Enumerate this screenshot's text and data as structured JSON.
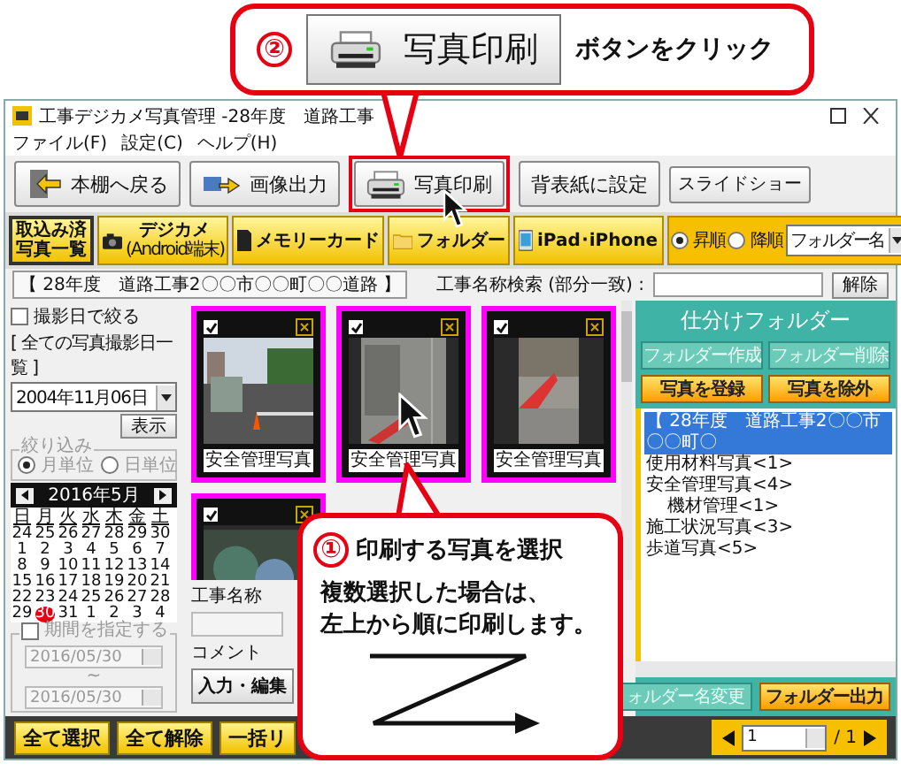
{
  "window": {
    "title": "工事デジカメ写真管理 -28年度　道路工事"
  },
  "menu": [
    "ファイル(F)",
    "設定(C)",
    "ヘルプ(H)"
  ],
  "toolbar": [
    {
      "label": "本棚へ戻る",
      "kind": "back",
      "highlighted": false
    },
    {
      "label": "画像出力",
      "kind": "export",
      "highlighted": false
    },
    {
      "label": "写真印刷",
      "kind": "print",
      "highlighted": true
    },
    {
      "label": "背表紙に設定",
      "kind": "plain",
      "highlighted": false
    },
    {
      "label": "スライドショー",
      "kind": "small",
      "highlighted": false
    }
  ],
  "sources": [
    {
      "lines": [
        "取込み済",
        "写真一覧"
      ],
      "kind": "list",
      "selected": true
    },
    {
      "lines": [
        "デジカメ",
        "(Android端末)"
      ],
      "kind": "camera",
      "selected": false
    },
    {
      "lines": [
        "メモリーカード"
      ],
      "kind": "card",
      "selected": false
    },
    {
      "lines": [
        "フォルダー"
      ],
      "kind": "folder",
      "selected": false
    },
    {
      "lines": [
        "iPad･iPhone"
      ],
      "kind": "tablet",
      "selected": false
    }
  ],
  "sort": {
    "options": [
      {
        "label": "昇順",
        "selected": true
      },
      {
        "label": "降順",
        "selected": false
      }
    ],
    "field": "フォルダー名"
  },
  "path": {
    "value": "【 28年度　道路工事2〇〇市〇〇町〇〇道路 】",
    "search_label": "工事名称検索 (部分一致) :",
    "clear": "解除"
  },
  "date_filter": {
    "label": "撮影日で絞る",
    "checked": false,
    "list_title": "[ 全ての写真撮影日一覧 ]",
    "date": "2004年11月06日",
    "show": "表示",
    "narrow_title": "絞り込み",
    "narrow": [
      {
        "label": "月単位",
        "selected": true
      },
      {
        "label": "日単位",
        "selected": false
      }
    ]
  },
  "calendar": {
    "month": "2016年5月",
    "weekdays": [
      "日",
      "月",
      "火",
      "水",
      "木",
      "金",
      "土"
    ],
    "weeks": [
      [
        {
          "day": "24",
          "selected": false
        },
        {
          "day": "25",
          "selected": false
        },
        {
          "day": "26",
          "selected": false
        },
        {
          "day": "27",
          "selected": false
        },
        {
          "day": "28",
          "selected": false
        },
        {
          "day": "29",
          "selected": false
        },
        {
          "day": "30",
          "selected": false
        }
      ],
      [
        {
          "day": "1",
          "selected": false
        },
        {
          "day": "2",
          "selected": false
        },
        {
          "day": "3",
          "selected": false
        },
        {
          "day": "4",
          "selected": false
        },
        {
          "day": "5",
          "selected": false
        },
        {
          "day": "6",
          "selected": false
        },
        {
          "day": "7",
          "selected": false
        }
      ],
      [
        {
          "day": "8",
          "selected": false
        },
        {
          "day": "9",
          "selected": false
        },
        {
          "day": "10",
          "selected": false
        },
        {
          "day": "11",
          "selected": false
        },
        {
          "day": "12",
          "selected": false
        },
        {
          "day": "13",
          "selected": false
        },
        {
          "day": "14",
          "selected": false
        }
      ],
      [
        {
          "day": "15",
          "selected": false
        },
        {
          "day": "16",
          "selected": false
        },
        {
          "day": "17",
          "selected": false
        },
        {
          "day": "18",
          "selected": false
        },
        {
          "day": "19",
          "selected": false
        },
        {
          "day": "20",
          "selected": false
        },
        {
          "day": "21",
          "selected": false
        }
      ],
      [
        {
          "day": "22",
          "selected": false
        },
        {
          "day": "23",
          "selected": false
        },
        {
          "day": "24",
          "selected": false
        },
        {
          "day": "25",
          "selected": false
        },
        {
          "day": "26",
          "selected": false
        },
        {
          "day": "27",
          "selected": false
        },
        {
          "day": "28",
          "selected": false
        }
      ],
      [
        {
          "day": "29",
          "selected": false
        },
        {
          "day": "30",
          "selected": true
        },
        {
          "day": "31",
          "selected": false
        },
        {
          "day": "1",
          "selected": false
        },
        {
          "day": "2",
          "selected": false
        },
        {
          "day": "3",
          "selected": false
        },
        {
          "day": "4",
          "selected": false
        }
      ]
    ]
  },
  "period": {
    "label": "期間を指定する",
    "checked": false,
    "from": "2016/05/30",
    "separator": "~",
    "to": "2016/05/30"
  },
  "photos": [
    {
      "kind": "street",
      "checked": true,
      "caption": "安全管理写真"
    },
    {
      "kind": "site",
      "checked": true,
      "caption": "安全管理写真"
    },
    {
      "kind": "sidewalk",
      "checked": true,
      "caption": "安全管理写真"
    },
    {
      "kind": "trees",
      "checked": true
    }
  ],
  "details": {
    "name_label": "工事名称",
    "comment_label": "コメント",
    "edit": "入力・編集"
  },
  "folders": {
    "title": "仕分けフォルダー",
    "actions": [
      {
        "label": "フォルダー作成",
        "disabled": true
      },
      {
        "label": "フォルダー削除",
        "disabled": true
      },
      {
        "label": "写真を登録",
        "disabled": false
      },
      {
        "label": "写真を除外",
        "disabled": false
      }
    ],
    "tree": [
      {
        "label": "【 28年度　道路工事2〇〇市〇〇町〇",
        "selected": true
      },
      {
        "label": "使用材料写真<1>",
        "selected": false
      },
      {
        "label": "安全管理写真<4>",
        "selected": false,
        "children": [
          {
            "label": "機材管理<1>",
            "selected": false
          }
        ]
      },
      {
        "label": "施工状況写真<3>",
        "selected": false
      },
      {
        "label": "歩道写真<5>",
        "selected": false
      }
    ],
    "buttons": [
      {
        "label": "ォルダー名変更",
        "disabled": true
      },
      {
        "label": "フォルダー出力",
        "disabled": false
      }
    ]
  },
  "bottom": {
    "buttons": [
      "全て選択",
      "全て解除",
      "一括リ"
    ],
    "page": "1",
    "total": "/ 1"
  },
  "callouts": [
    {
      "number": "②",
      "button": "写真印刷",
      "text": "ボタンをクリック"
    },
    {
      "number": "①",
      "title": "印刷する写真を選択",
      "lines": [
        "複数選択した場合は、",
        "左上から順に印刷します。"
      ]
    }
  ]
}
